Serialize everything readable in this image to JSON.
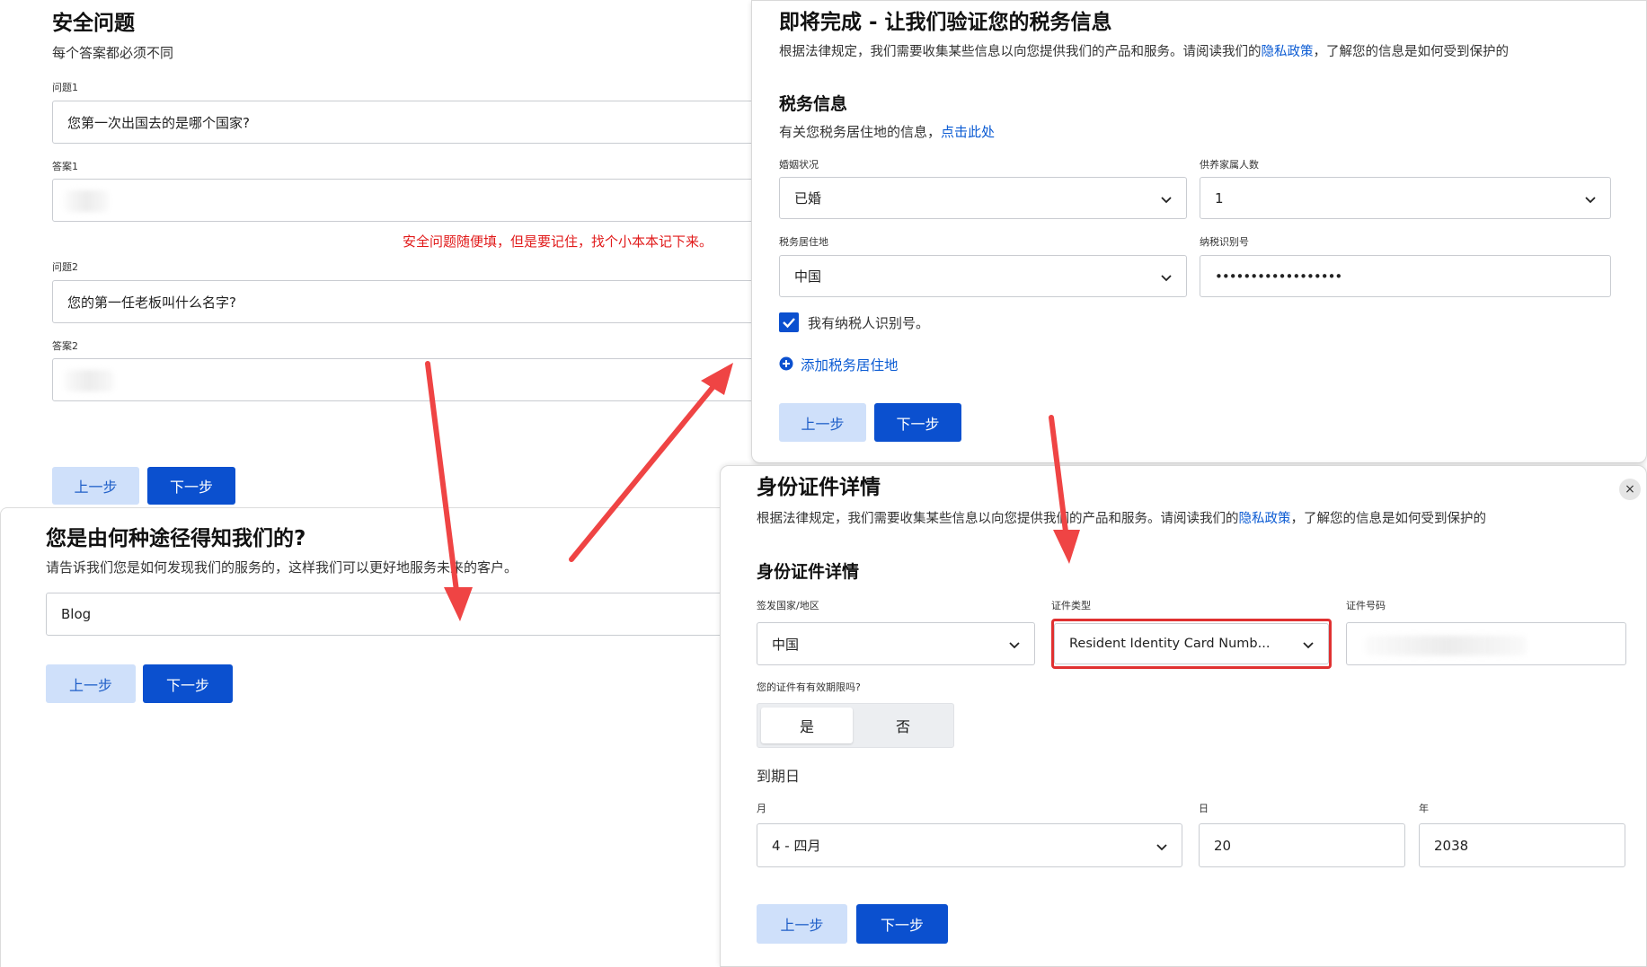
{
  "security": {
    "title": "安全问题",
    "subtitle": "每个答案都必须不同",
    "q1_label": "问题1",
    "q1_value": "您第一次出国去的是哪个国家?",
    "a1_label": "答案1",
    "note": "安全问题随便填，但是要记住，找个小本本记下来。",
    "q2_label": "问题2",
    "q2_value": "您的第一任老板叫什么名字?",
    "a2_label": "答案2",
    "prev": "上一步",
    "next": "下一步"
  },
  "source": {
    "title": "您是由何种途径得知我们的?",
    "subtitle": "请告诉我们您是如何发现我们的服务的，这样我们可以更好地服务未来的客户。",
    "value": "Blog",
    "prev": "上一步",
    "next": "下一步"
  },
  "tax": {
    "title": "即将完成 - 让我们验证您的税务信息",
    "intro_prefix": "根据法律规定，我们需要收集某些信息以向您提供我们的产品和服务。请阅读我们的",
    "privacy_link": "隐私政策",
    "intro_suffix": "，了解您的信息是如何受到保护的",
    "section": "税务信息",
    "residence_note": "有关您税务居住地的信息，",
    "click_here": "点击此处",
    "marital_label": "婚姻状况",
    "marital_value": "已婚",
    "dependents_label": "供养家属人数",
    "dependents_value": "1",
    "residence_label": "税务居住地",
    "residence_value": "中国",
    "tin_label": "纳税识别号",
    "tin_value": "••••••••••••••••••",
    "has_tin": "我有纳税人识别号。",
    "add_residence": "添加税务居住地",
    "prev": "上一步",
    "next": "下一步"
  },
  "identity": {
    "title": "身份证件详情",
    "intro_prefix": "根据法律规定，我们需要收集某些信息以向您提供我们的产品和服务。请阅读我们的",
    "privacy_link": "隐私政策",
    "intro_suffix": "，了解您的信息是如何受到保护的",
    "section": "身份证件详情",
    "country_label": "签发国家/地区",
    "country_value": "中国",
    "doc_type_label": "证件类型",
    "doc_type_value": "Resident Identity Card Numb...",
    "doc_number_label": "证件号码",
    "expiry_question": "您的证件有有效期限吗?",
    "yes": "是",
    "no": "否",
    "expiry_title": "到期日",
    "month_label": "月",
    "month_value": "4 - 四月",
    "day_label": "日",
    "day_value": "20",
    "year_label": "年",
    "year_value": "2038",
    "prev": "上一步",
    "next": "下一步",
    "close": "×"
  },
  "colors": {
    "primary": "#0b50cf",
    "secondary": "#cfe0fa",
    "link": "#0b5bd3",
    "annotation_red": "#e03131"
  }
}
